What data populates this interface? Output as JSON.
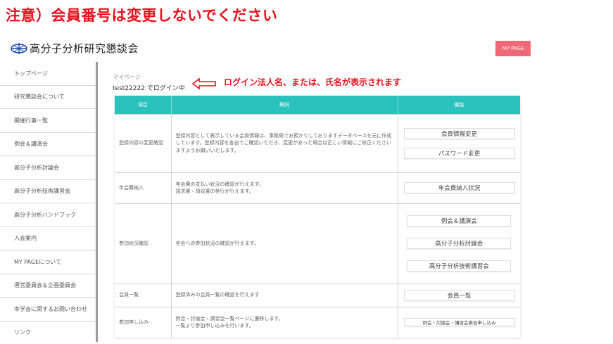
{
  "notice": "注意）会員番号は変更しないでください",
  "header": {
    "org_name": "高分子分析研究懇談会",
    "mypage_label": "MY PAGE"
  },
  "sidebar": {
    "items": [
      "トップページ",
      "研究懇談会について",
      "開催行事一覧",
      "例会＆講演会",
      "高分子分析討論会",
      "高分子分析技術講習会",
      "高分子分析ハンドブック",
      "入会案内",
      "MY PAGEについて",
      "運営委員会＆企画委員会",
      "本学会に関するお問い合わせ",
      "リンク"
    ]
  },
  "main": {
    "breadcrumb": "マイページ",
    "login_text": "test22222 でログイン中",
    "annotation": "ログイン法人名、または、氏名が表示されます",
    "table": {
      "headers": [
        "項目",
        "解説",
        "機能"
      ],
      "rows": [
        {
          "item": "登録内容の変更確認",
          "desc": "登録内容として表示している会員情報は、事務局でお預かりしておりますデータベースを元に作成しています。登録内容を各自でご確認いただき、変更があった場合は正しい情報にご修正くださいますようお願いいたします。",
          "actions": [
            "会員情報変更",
            "パスワード変更"
          ]
        },
        {
          "item": "年会費納入",
          "desc": "年会費の支払い状況の確認が行えます。\n請求書・領収書の発行が行えます。",
          "actions": [
            "年会費納入状況"
          ]
        },
        {
          "item": "参加状況確認",
          "desc": "各会への参加状況の確認が行えます。",
          "actions": [
            "例会＆講演会",
            "高分子分析討論会",
            "高分子分析技術講習会"
          ]
        },
        {
          "item": "会員一覧",
          "desc": "登録済みの会員一覧の確認を行えます",
          "actions": [
            "会員一覧"
          ]
        },
        {
          "item": "参加申し込み",
          "desc": "例会・討論会・講習会一覧ページに遷移します。\n一覧より参加申し込みを行います。",
          "actions": [
            "例会・討論会・講習会参加申し込み"
          ]
        }
      ]
    }
  },
  "colors": {
    "accent": "#29c2bc",
    "notice_red": "#e8101d",
    "mypage_pink": "#f06878"
  }
}
